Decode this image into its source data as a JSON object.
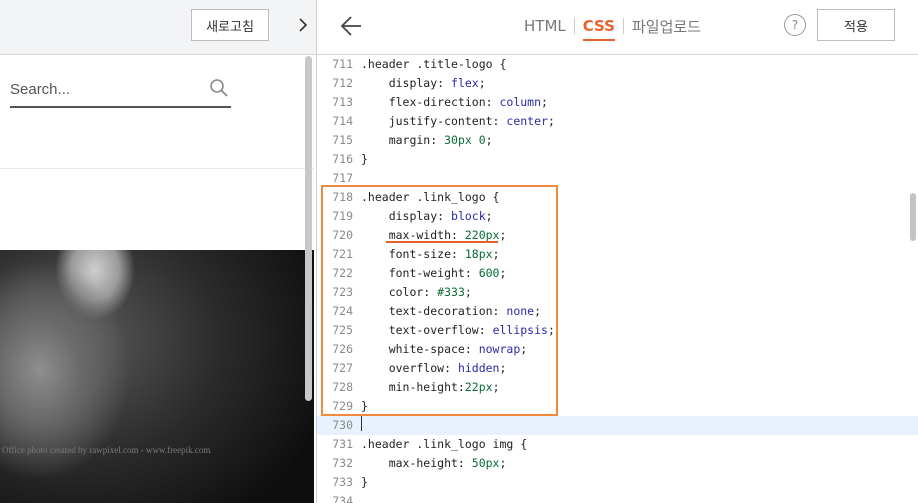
{
  "left_panel": {
    "refresh_label": "새로고침",
    "collapse_icon": "chevron-right-icon",
    "search": {
      "placeholder": "Search...",
      "icon": "search-icon"
    },
    "image_credit": "Office photo created by rawpixel.com - www.freepik.com"
  },
  "editor": {
    "back_icon": "arrow-left-icon",
    "tabs": [
      {
        "label": "HTML",
        "active": false
      },
      {
        "label": "CSS",
        "active": true
      },
      {
        "label": "파일업로드",
        "active": false
      }
    ],
    "help_label": "?",
    "apply_label": "적용",
    "accent_color": "#e8612c",
    "lines": [
      {
        "num": "711",
        "text": ".header .title-logo {"
      },
      {
        "num": "712",
        "text": "    display: flex;"
      },
      {
        "num": "713",
        "text": "    flex-direction: column;"
      },
      {
        "num": "714",
        "text": "    justify-content: center;"
      },
      {
        "num": "715",
        "text": "    margin: 30px 0;"
      },
      {
        "num": "716",
        "text": "}"
      },
      {
        "num": "717",
        "text": ""
      },
      {
        "num": "718",
        "text": ".header .link_logo {"
      },
      {
        "num": "719",
        "text": "    display: block;"
      },
      {
        "num": "720",
        "text": "    max-width: 220px;"
      },
      {
        "num": "721",
        "text": "    font-size: 18px;"
      },
      {
        "num": "722",
        "text": "    font-weight: 600;"
      },
      {
        "num": "723",
        "text": "    color: #333;"
      },
      {
        "num": "724",
        "text": "    text-decoration: none;"
      },
      {
        "num": "725",
        "text": "    text-overflow: ellipsis;"
      },
      {
        "num": "726",
        "text": "    white-space: nowrap;"
      },
      {
        "num": "727",
        "text": "    overflow: hidden;"
      },
      {
        "num": "728",
        "text": "    min-height:22px;"
      },
      {
        "num": "729",
        "text": "}"
      },
      {
        "num": "730",
        "text": ""
      },
      {
        "num": "731",
        "text": ".header .link_logo img {"
      },
      {
        "num": "732",
        "text": "    max-height: 50px;"
      },
      {
        "num": "733",
        "text": "}"
      },
      {
        "num": "734",
        "text": ""
      }
    ],
    "current_line": "730"
  }
}
